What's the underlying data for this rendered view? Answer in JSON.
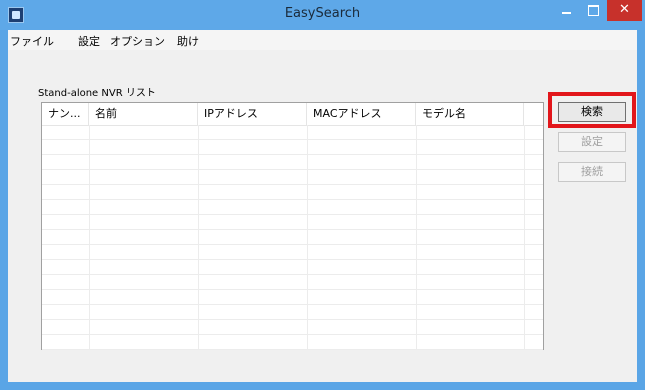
{
  "window": {
    "title": "EasySearch",
    "close_glyph": "✕"
  },
  "menu": [
    {
      "label": "ファイル"
    },
    {
      "label": "設定"
    },
    {
      "label": "オプション"
    },
    {
      "label": "助け"
    }
  ],
  "list": {
    "caption": "Stand-alone NVR リスト",
    "columns": [
      "ナン...",
      "名前",
      "IPアドレス",
      "MACアドレス",
      "モデル名"
    ],
    "rows": []
  },
  "buttons": {
    "search": "検索",
    "settings": "設定",
    "connect": "接続"
  },
  "colors": {
    "titlebar": "#5ea8e8",
    "close": "#c7312b",
    "highlight": "#e2161b"
  },
  "icons": [
    "app-icon",
    "minimize-icon",
    "maximize-icon",
    "close-icon"
  ]
}
